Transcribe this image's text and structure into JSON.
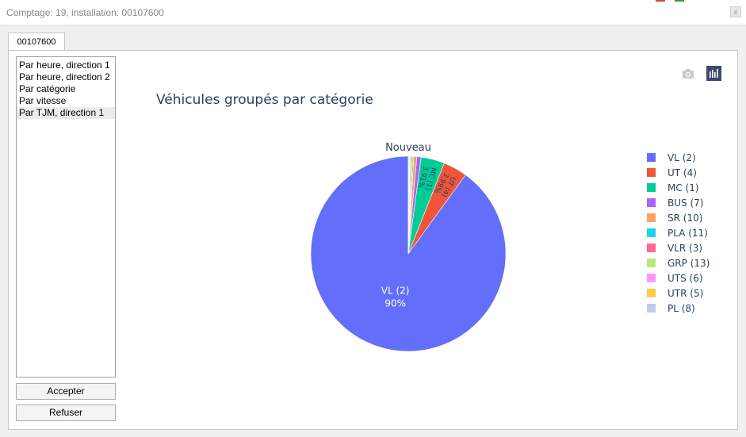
{
  "window": {
    "title": "Comptage: 19, installation: 00107600",
    "close_glyph": "x"
  },
  "tabs": [
    {
      "label": "00107600"
    }
  ],
  "sidebar": {
    "items": [
      {
        "label": "Par heure, direction 1"
      },
      {
        "label": "Par heure, direction 2"
      },
      {
        "label": "Par catégorie"
      },
      {
        "label": "Par vitesse"
      },
      {
        "label": "Par TJM, direction 1",
        "selected": true
      }
    ],
    "accept_label": "Accepter",
    "refuse_label": "Refuser"
  },
  "toolbar": {
    "camera_icon": "camera-icon",
    "chart_icon": "bar-chart-icon"
  },
  "chart_data": {
    "type": "pie",
    "title": "Véhicules groupés par catégorie",
    "pie_label": "Nouveau",
    "slices": [
      {
        "label": "VL (2)",
        "value": 90.0,
        "percent_text": "90%",
        "color": "#636efa"
      },
      {
        "label": "UT (4)",
        "value": 3.99,
        "percent_text": "3.99%",
        "color": "#ef553b"
      },
      {
        "label": "MC (1)",
        "value": 3.91,
        "percent_text": "3.91%",
        "color": "#00cc96"
      },
      {
        "label": "BUS (7)",
        "value": 0.7,
        "percent_text": "",
        "color": "#ab63fa"
      },
      {
        "label": "SR (10)",
        "value": 0.5,
        "percent_text": "",
        "color": "#ffa15a"
      },
      {
        "label": "PLA (11)",
        "value": 0.2,
        "percent_text": "",
        "color": "#19d3f3"
      },
      {
        "label": "VLR (3)",
        "value": 0.15,
        "percent_text": "",
        "color": "#ff6692"
      },
      {
        "label": "GRP (13)",
        "value": 0.25,
        "percent_text": "",
        "color": "#b6e880"
      },
      {
        "label": "UTS (6)",
        "value": 0.1,
        "percent_text": "",
        "color": "#ff97ff"
      },
      {
        "label": "UTR (5)",
        "value": 0.1,
        "percent_text": "",
        "color": "#fecb52"
      },
      {
        "label": "PL (8)",
        "value": 0.1,
        "percent_text": "",
        "color": "#c6c8ef"
      }
    ],
    "legend": "right",
    "direction": "counterclockwise",
    "start": "top"
  }
}
